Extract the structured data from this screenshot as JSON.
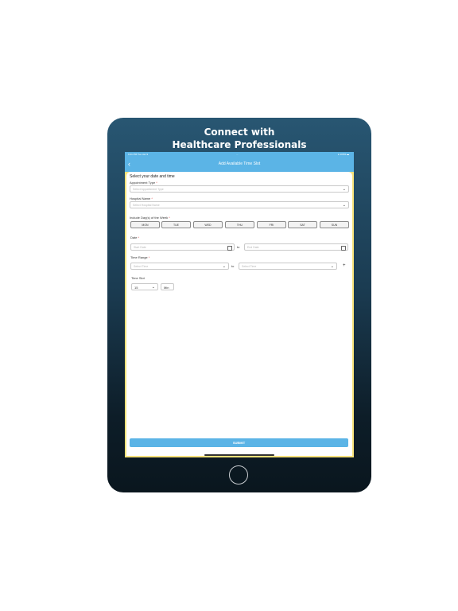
{
  "promo": {
    "line1": "Connect with",
    "line2": "Healthcare Professionals"
  },
  "status_bar": {
    "time": "9:41 PM   Tue Jan 9",
    "center": "...",
    "right": "● 100% ▬"
  },
  "nav": {
    "back": "‹",
    "title": "Add Available Time Slot"
  },
  "form": {
    "heading": "Select your date and time",
    "appointment_type": {
      "label": "Appointment Type",
      "placeholder": "Select Appointment Type"
    },
    "hospital_name": {
      "label": "Hospital Name",
      "placeholder": "Select Hospital Name"
    },
    "days": {
      "label": "Include Day(s) of the Week",
      "items": [
        "MON",
        "TUE",
        "WED",
        "THU",
        "FRI",
        "SAT",
        "SUN"
      ]
    },
    "date": {
      "label": "Date",
      "start_placeholder": "Start Date",
      "to": "to",
      "end_placeholder": "End Date"
    },
    "time_range": {
      "label": "Time Range",
      "start_placeholder": "Select Time",
      "to": "to",
      "end_placeholder": "Select Time",
      "add": "+"
    },
    "time_slot": {
      "label": "Time Slot",
      "value": "15",
      "unit": "Min"
    },
    "required_marker": "*",
    "submit": "SUBMIT"
  }
}
